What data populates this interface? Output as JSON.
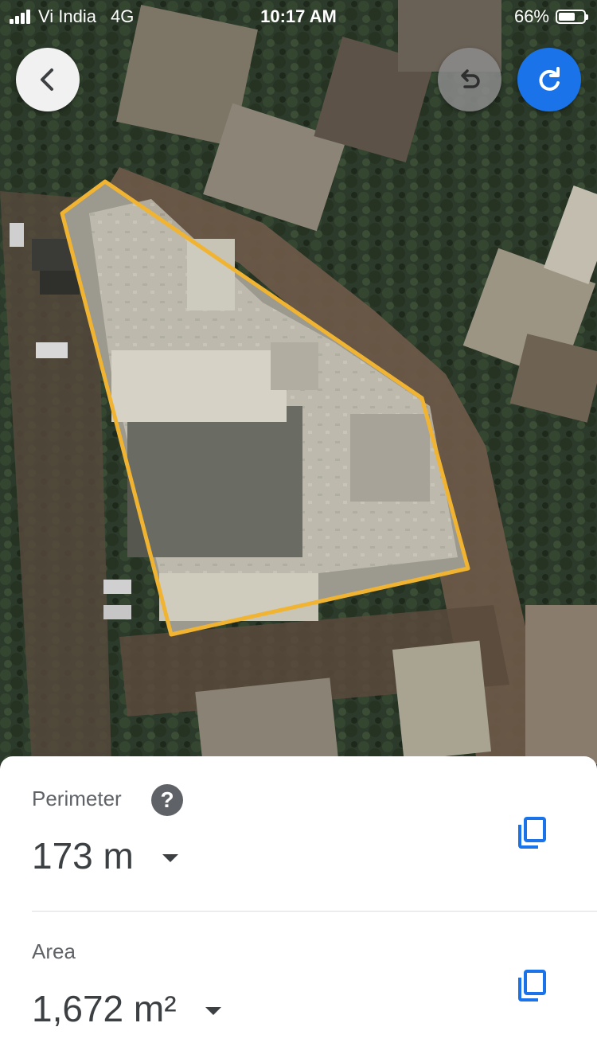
{
  "status_bar": {
    "carrier": "Vi India",
    "network": "4G",
    "time": "10:17 AM",
    "battery_percent": "66%",
    "battery_level": 0.66
  },
  "map": {
    "type": "satellite",
    "outline_color": "#f0b432"
  },
  "controls": {
    "back_icon": "chevron-left-icon",
    "undo_icon": "undo-icon",
    "redo_icon": "redo-icon",
    "redo_color": "#1a73e8"
  },
  "measurements": {
    "perimeter": {
      "label": "Perimeter",
      "help_glyph": "?",
      "value": "173 m"
    },
    "area": {
      "label": "Area",
      "value": "1,672 m²"
    }
  },
  "accent_color": "#1a73e8"
}
